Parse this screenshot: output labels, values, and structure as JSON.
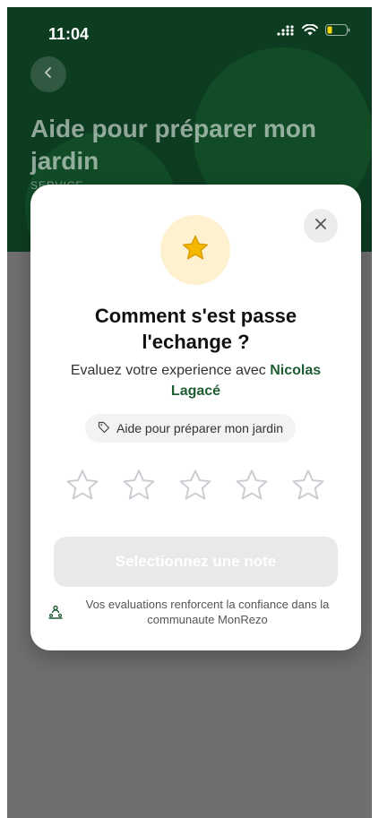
{
  "status_bar": {
    "time": "11:04"
  },
  "page": {
    "title": "Aide pour préparer mon jardin",
    "category": "SERVICE"
  },
  "modal": {
    "title": "Comment s'est passe l'echange ?",
    "subtitle_prefix": "Evaluez votre experience avec ",
    "subtitle_name": "Nicolas Lagacé",
    "service_tag": "Aide pour préparer mon jardin",
    "rating": {
      "max": 5,
      "selected": 0
    },
    "submit_label": "Selectionnez une note",
    "footer_note": "Vos evaluations renforcent la confiance dans la communaute MonRezo"
  },
  "colors": {
    "hero_bg": "#0d3d20",
    "accent_green": "#1e5c32",
    "star_fill": "#f5b800",
    "overlay": "#6f6f6f"
  },
  "icons": {
    "back": "chevron-left-icon",
    "close": "close-icon",
    "badge": "star-icon",
    "tag": "tag-icon",
    "footer": "community-icon"
  }
}
